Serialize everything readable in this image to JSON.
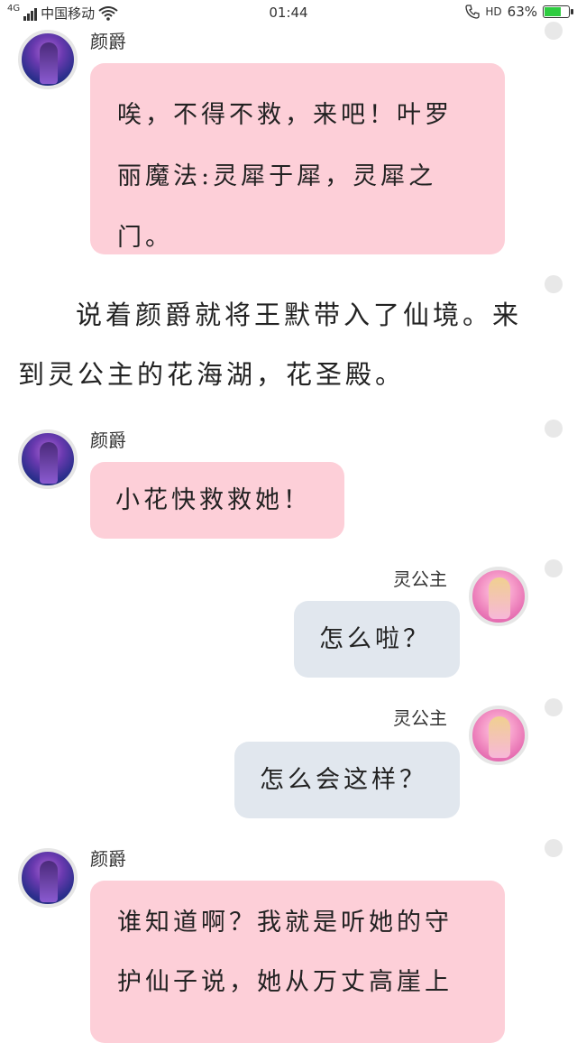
{
  "status_bar": {
    "network": "4G",
    "carrier": "中国移动",
    "time": "01:44",
    "hd": "HD",
    "battery": "63%",
    "battery_level": 0.63
  },
  "messages": [
    {
      "speaker": "颜爵",
      "text": "唉，不得不救，来吧！叶罗丽魔法:灵犀于犀，灵犀之门。"
    },
    {
      "narration": "说着颜爵就将王默带入了仙境。来到灵公主的花海湖，花圣殿。"
    },
    {
      "speaker": "颜爵",
      "text": "小花快救救她！"
    },
    {
      "speaker": "灵公主",
      "text": "怎么啦？"
    },
    {
      "speaker": "灵公主",
      "text": "怎么会这样？"
    },
    {
      "speaker": "颜爵",
      "text": "谁知道啊？我就是听她的守护仙子说，她从万丈高崖上"
    }
  ],
  "colors": {
    "pink_bubble": "#fdcfd8",
    "grey_bubble": "#e1e7ee",
    "dot": "#e8e8e8",
    "battery_fill": "#2ecc40"
  },
  "icons": [
    "signal-icon",
    "wifi-icon",
    "call-icon",
    "battery-icon",
    "avatar-yanjue",
    "avatar-princess"
  ]
}
